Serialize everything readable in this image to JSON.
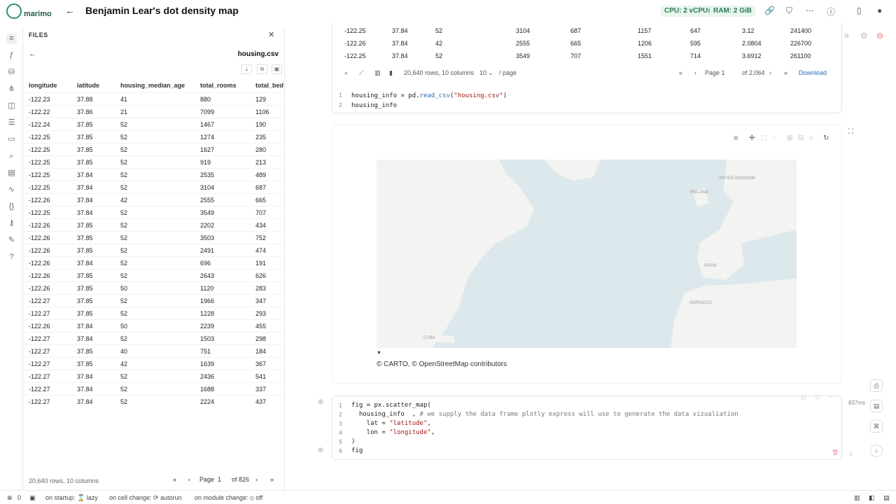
{
  "header": {
    "logo_text": "marimo",
    "title": "Benjamin Lear's dot density map",
    "cpu": "CPU: 2 vCPUs",
    "ram": "RAM: 2 GiB"
  },
  "files": {
    "title": "FILES",
    "filename": "housing.csv",
    "columns": [
      "longitude",
      "latitude",
      "housing_median_age",
      "total_rooms",
      "total_bed"
    ],
    "rows": [
      [
        "-122.23",
        "37.88",
        "41",
        "880",
        "129"
      ],
      [
        "-122.22",
        "37.86",
        "21",
        "7099",
        "1106"
      ],
      [
        "-122.24",
        "37.85",
        "52",
        "1467",
        "190"
      ],
      [
        "-122.25",
        "37.85",
        "52",
        "1274",
        "235"
      ],
      [
        "-122.25",
        "37.85",
        "52",
        "1627",
        "280"
      ],
      [
        "-122.25",
        "37.85",
        "52",
        "919",
        "213"
      ],
      [
        "-122.25",
        "37.84",
        "52",
        "2535",
        "489"
      ],
      [
        "-122.25",
        "37.84",
        "52",
        "3104",
        "687"
      ],
      [
        "-122.26",
        "37.84",
        "42",
        "2555",
        "665"
      ],
      [
        "-122.25",
        "37.84",
        "52",
        "3549",
        "707"
      ],
      [
        "-122.26",
        "37.85",
        "52",
        "2202",
        "434"
      ],
      [
        "-122.26",
        "37.85",
        "52",
        "3503",
        "752"
      ],
      [
        "-122.26",
        "37.85",
        "52",
        "2491",
        "474"
      ],
      [
        "-122.26",
        "37.84",
        "52",
        "696",
        "191"
      ],
      [
        "-122.26",
        "37.85",
        "52",
        "2643",
        "626"
      ],
      [
        "-122.26",
        "37.85",
        "50",
        "1120",
        "283"
      ],
      [
        "-122.27",
        "37.85",
        "52",
        "1966",
        "347"
      ],
      [
        "-122.27",
        "37.85",
        "52",
        "1228",
        "293"
      ],
      [
        "-122.26",
        "37.84",
        "50",
        "2239",
        "455"
      ],
      [
        "-122.27",
        "37.84",
        "52",
        "1503",
        "298"
      ],
      [
        "-122.27",
        "37.85",
        "40",
        "751",
        "184"
      ],
      [
        "-122.27",
        "37.85",
        "42",
        "1639",
        "367"
      ],
      [
        "-122.27",
        "37.84",
        "52",
        "2436",
        "541"
      ],
      [
        "-122.27",
        "37.84",
        "52",
        "1688",
        "337"
      ],
      [
        "-122.27",
        "37.84",
        "52",
        "2224",
        "437"
      ]
    ],
    "footer": "20,640 rows, 10 columns",
    "page_label": "Page",
    "page_value": "1",
    "page_of": "of 826"
  },
  "output_table": {
    "rows": [
      [
        "-122.25",
        "37.84",
        "52",
        "3104",
        "687",
        "1157",
        "647",
        "3.12",
        "241400"
      ],
      [
        "-122.26",
        "37.84",
        "42",
        "2555",
        "665",
        "1206",
        "595",
        "2.0804",
        "226700"
      ],
      [
        "-122.25",
        "37.84",
        "52",
        "3549",
        "707",
        "1551",
        "714",
        "3.6912",
        "261100"
      ]
    ],
    "row_count": "20,640 rows, 10 columns",
    "per_page": "10",
    "per_page_suffix": "/ page",
    "page_label": "Page 1",
    "page_of": "of 2,064",
    "download": "Download"
  },
  "cell1": {
    "line1_a": "housing_info = pd.",
    "line1_fn": "read_csv",
    "line1_b": "(",
    "line1_str": "\"housing.csv\"",
    "line1_c": ")",
    "line2": "housing_info"
  },
  "map": {
    "labels": [
      "UNITED KINGDOM",
      "IRELAND",
      "SPAIN",
      "MOROCCO",
      "CUBA"
    ],
    "attribution": "© CARTO, © OpenStreetMap contributors"
  },
  "cell2": {
    "l1": "fig = px.scatter_map(",
    "l2_a": "  housing_info  ,",
    "l2_cmt": " # we supply the data frame plotly express will use to generate the data vizualiation",
    "l3_a": "    lat = ",
    "l3_str": "\"latitude\"",
    "l3_b": ",",
    "l4_a": "    lon = ",
    "l4_str": "\"longitude\"",
    "l4_b": ",",
    "l5": ")",
    "l6": "fig",
    "timing": "837ms"
  },
  "status": {
    "count": "0",
    "startup": "on startup: ⌛ lazy",
    "cell_change": "on cell change: ⟳ autorun",
    "module_change": "on module change: ⦸ off"
  },
  "colors": {
    "accent": "#2f8f6f",
    "badge_bg": "#e8f6ee",
    "map_water": "#dce8ec",
    "map_land": "#f3f3f1"
  }
}
